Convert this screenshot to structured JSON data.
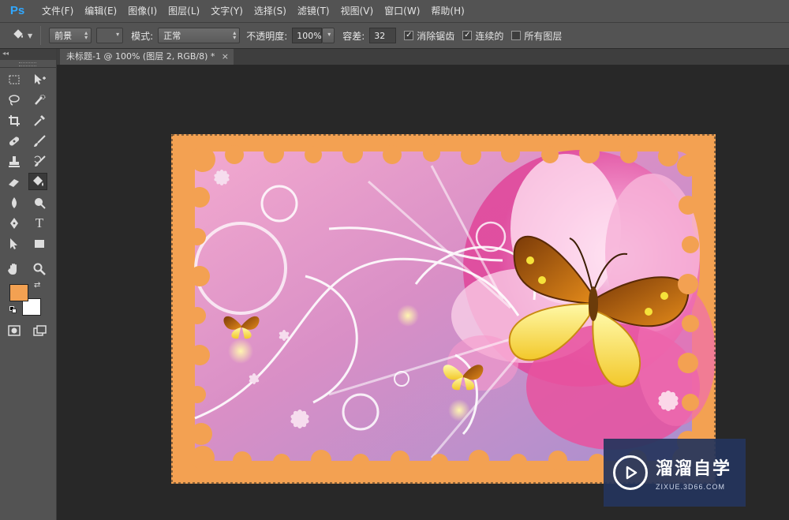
{
  "app": {
    "logo": "Ps",
    "accent": "#31a8ff"
  },
  "menu": [
    {
      "label": "文件(F)"
    },
    {
      "label": "编辑(E)"
    },
    {
      "label": "图像(I)"
    },
    {
      "label": "图层(L)"
    },
    {
      "label": "文字(Y)"
    },
    {
      "label": "选择(S)"
    },
    {
      "label": "滤镜(T)"
    },
    {
      "label": "视图(V)"
    },
    {
      "label": "窗口(W)"
    },
    {
      "label": "帮助(H)"
    }
  ],
  "options": {
    "tool_icon": "paint-bucket-icon",
    "fill_source": "前景",
    "mode_label": "模式:",
    "mode_value": "正常",
    "opacity_label": "不透明度:",
    "opacity_value": "100%",
    "tolerance_label": "容差:",
    "tolerance_value": "32",
    "antialias_label": "消除锯齿",
    "antialias_checked": true,
    "contiguous_label": "连续的",
    "contiguous_checked": true,
    "all_layers_label": "所有图层",
    "all_layers_checked": false
  },
  "toolbox": {
    "collapse_glyph": "◂◂",
    "tools": [
      {
        "name": "rectangular-marquee-icon"
      },
      {
        "name": "move-icon"
      },
      {
        "name": "lasso-icon"
      },
      {
        "name": "quick-selection-icon"
      },
      {
        "name": "crop-icon"
      },
      {
        "name": "eyedropper-icon"
      },
      {
        "name": "spot-healing-icon"
      },
      {
        "name": "brush-icon"
      },
      {
        "name": "clone-stamp-icon"
      },
      {
        "name": "history-brush-icon"
      },
      {
        "name": "eraser-icon"
      },
      {
        "name": "paint-bucket-icon",
        "active": true
      },
      {
        "name": "blur-icon"
      },
      {
        "name": "dodge-icon"
      },
      {
        "name": "pen-icon"
      },
      {
        "name": "type-icon",
        "label": "T"
      },
      {
        "name": "path-selection-icon"
      },
      {
        "name": "rectangle-shape-icon"
      },
      {
        "name": "hand-icon"
      },
      {
        "name": "zoom-icon"
      },
      {
        "name": "quick-mask-icon"
      },
      {
        "name": "screen-mode-icon"
      }
    ],
    "foreground_color": "#f3a152",
    "background_color": "#ffffff"
  },
  "document": {
    "tab_title": "未标题-1 @ 100% (图层 2, RGB/8) *",
    "close_glyph": "×"
  },
  "watermark": {
    "title": "溜溜自学",
    "subtitle": "ZIXUE.3D66.COM"
  }
}
